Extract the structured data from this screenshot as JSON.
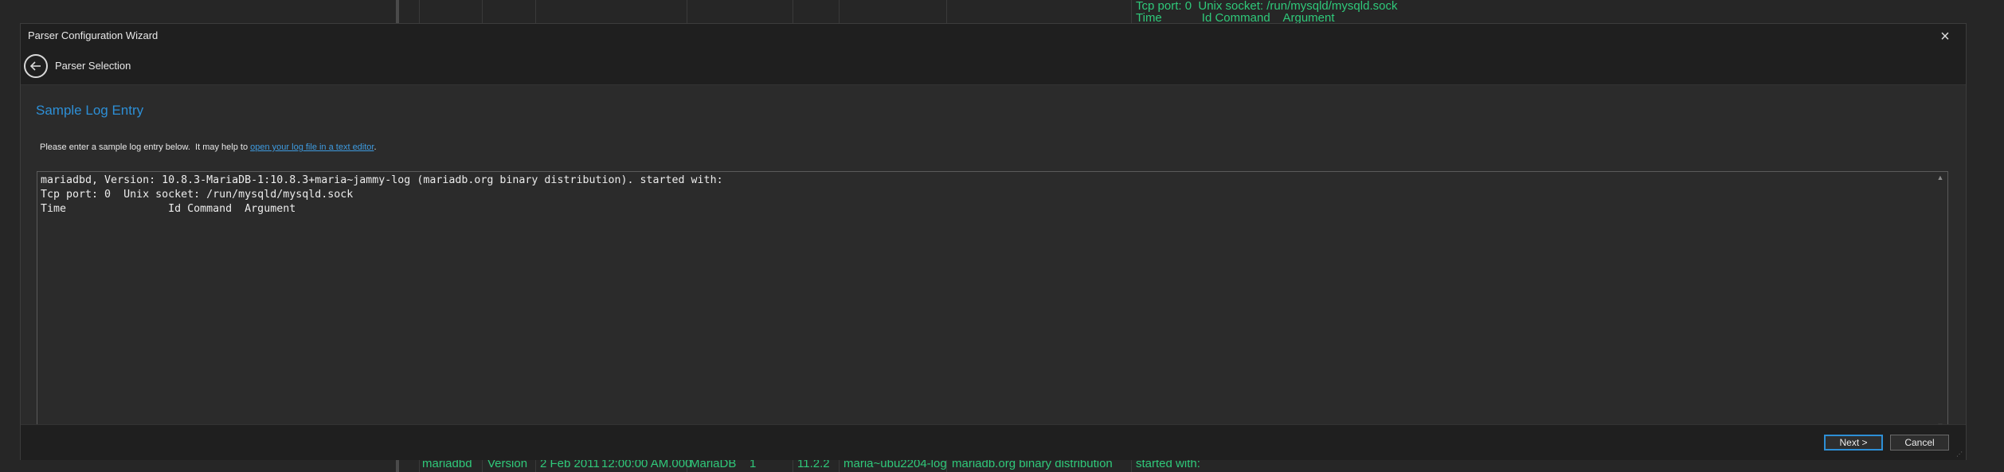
{
  "background": {
    "top_lines": [
      "Tcp port: 0  Unix socket: /run/mysqld/mysqld.sock",
      "Time            Id Command    Argument"
    ],
    "bottom_row": [
      "mariadbd",
      "Version",
      "2 Feb 2011",
      "12:00:00 AM.000",
      "MariaDB",
      "1",
      "11.2.2",
      "maria~ubu2204-log",
      "mariadb.org binary distribution",
      "started with:"
    ]
  },
  "dialog": {
    "title": "Parser Configuration Wizard",
    "close_symbol": "×",
    "nav_label": "Parser Selection"
  },
  "content": {
    "section_title": "Sample Log Entry",
    "instruction_prefix": "Please enter a sample log entry below.  It may help to ",
    "instruction_link": "open your log file in a text editor",
    "instruction_suffix": ".",
    "log_text": "mariadbd, Version: 10.8.3-MariaDB-1:10.8.3+maria~jammy-log (mariadb.org binary distribution). started with:\nTcp port: 0  Unix socket: /run/mysqld/mysqld.sock\nTime                Id Command  Argument"
  },
  "footer": {
    "next_label": "Next >",
    "cancel_label": "Cancel"
  },
  "colors": {
    "accent": "#2d8fd6",
    "link": "#3e9be0",
    "bg_text_green": "#2fc97a"
  }
}
